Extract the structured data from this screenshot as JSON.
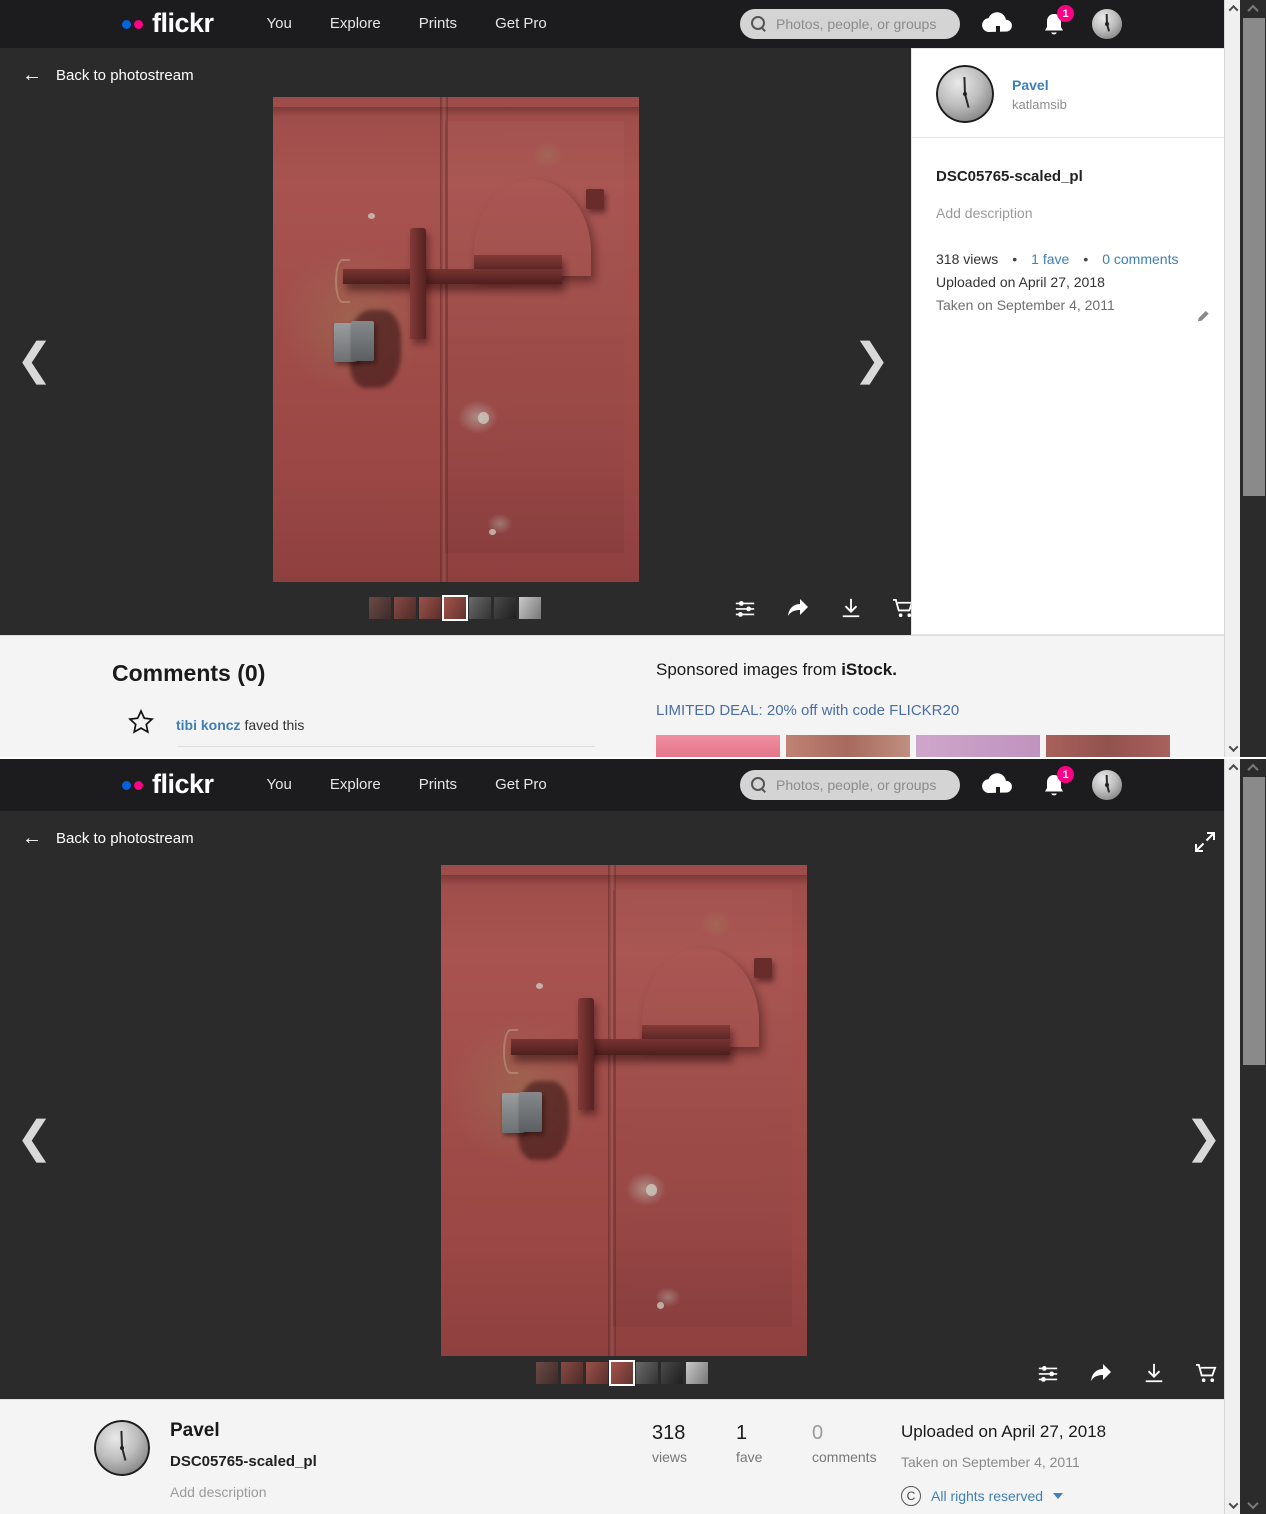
{
  "brand": {
    "name": "flickr",
    "dot_blue": "#0063dc",
    "dot_pink": "#ff0084"
  },
  "header": {
    "nav": [
      {
        "label": "You"
      },
      {
        "label": "Explore"
      },
      {
        "label": "Prints"
      },
      {
        "label": "Get Pro"
      }
    ],
    "search": {
      "placeholder": "Photos, people, or groups",
      "value": ""
    },
    "upload_icon": "cloud-upload-icon",
    "notifications_icon": "bell-icon",
    "notifications_count": "1",
    "avatar_icon": "user-avatar-clock"
  },
  "stage": {
    "back_label": "Back to photostream",
    "back_icon": "arrow-left-icon",
    "expand_icon": "expand-icon",
    "prev_icon": "chevron-left-icon",
    "next_icon": "chevron-right-icon",
    "photo_alt": "Red painted metal door with padlock",
    "thumbnail_count": 7,
    "selected_thumbnail_index": 3,
    "actions": [
      {
        "name": "adjust-icon",
        "label": "Adjust"
      },
      {
        "name": "share-icon",
        "label": "Share"
      },
      {
        "name": "download-icon",
        "label": "Download"
      },
      {
        "name": "cart-icon",
        "label": "Buy"
      }
    ]
  },
  "owner_popup": {
    "username": "Pavel",
    "alias": "katlamsib",
    "photo_title": "DSC05765-scaled_pl",
    "add_description": "Add description",
    "views": "318 views",
    "faves": "1 fave",
    "comments": "0 comments",
    "uploaded": "Uploaded on April 27, 2018",
    "taken": "Taken on September 4, 2011",
    "edit_icon": "pencil-icon",
    "separator": "•"
  },
  "comments_section": {
    "title": "Comments (0)",
    "fave_icon": "star-icon",
    "fave_user": "tibi koncz",
    "fave_text": " faved this"
  },
  "sponsored": {
    "heading_prefix": "Sponsored images from ",
    "heading_brand": "iStock.",
    "deal": "LIMITED DEAL: 20% off with code FLICKR20",
    "tiles": [
      {
        "name": "sponsored-tile-1",
        "color": "#e8808f"
      },
      {
        "name": "sponsored-tile-2",
        "color": "#b3766a"
      },
      {
        "name": "sponsored-tile-3",
        "color": "#c49cc0"
      },
      {
        "name": "sponsored-tile-4",
        "color": "#a8615c"
      }
    ]
  },
  "info_bar": {
    "username": "Pavel",
    "photo_title": "DSC05765-scaled_pl",
    "add_description": "Add description",
    "stats": [
      {
        "number": "318",
        "label": "views"
      },
      {
        "number": "1",
        "label": "fave"
      },
      {
        "number": "0",
        "label": "comments"
      }
    ],
    "uploaded": "Uploaded on April 27, 2018",
    "taken": "Taken on September 4, 2011",
    "license": "All rights reserved",
    "license_icon": "copyright-icon",
    "license_caret": "caret-down-icon"
  }
}
